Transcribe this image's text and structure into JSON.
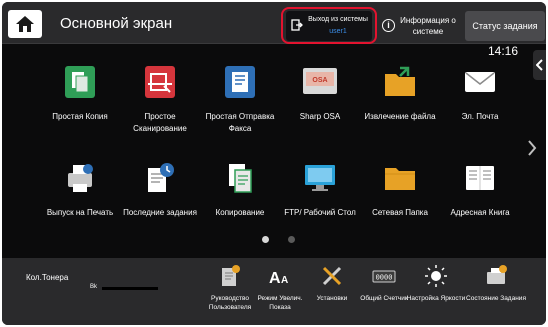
{
  "header": {
    "title": "Основной экран",
    "logout_label": "Выход из системы",
    "user_name": "user1",
    "info_label": "Информация о системе",
    "job_status_label": "Статус задания",
    "clock": "14:16"
  },
  "apps": [
    {
      "label": "Простая Копия",
      "icon": "copy-green-icon"
    },
    {
      "label": "Простое Сканирование",
      "icon": "scan-red-icon"
    },
    {
      "label": "Простая Отправка Факса",
      "icon": "fax-blue-icon"
    },
    {
      "label": "Sharp OSA",
      "icon": "sharp-osa-icon"
    },
    {
      "label": "Извлечение файла",
      "icon": "folder-retrieve-icon"
    },
    {
      "label": "Эл. Почта",
      "icon": "mail-icon"
    },
    {
      "label": "Выпуск на Печать",
      "icon": "print-release-icon"
    },
    {
      "label": "Последние задания",
      "icon": "recent-jobs-icon"
    },
    {
      "label": "Копирование",
      "icon": "copy-icon"
    },
    {
      "label": "FTP/ Рабочий Стол",
      "icon": "ftp-desktop-icon"
    },
    {
      "label": "Сетевая Папка",
      "icon": "network-folder-icon"
    },
    {
      "label": "Адресная Книга",
      "icon": "address-book-icon"
    }
  ],
  "pagination": {
    "pages": 2,
    "current": 1
  },
  "footer": {
    "toner_label": "Кол.Тонера",
    "toner_color": "Bk",
    "shortcuts": [
      {
        "label": "Руководство Пользователя",
        "icon": "manual-icon"
      },
      {
        "label": "Режим Увелич. Показа",
        "icon": "zoom-text-icon"
      },
      {
        "label": "Установки",
        "icon": "settings-tools-icon"
      },
      {
        "label": "Общий Счетчик",
        "icon": "counter-icon"
      },
      {
        "label": "Настройка Яркости",
        "icon": "brightness-icon"
      },
      {
        "label": "Состояние Задания",
        "icon": "job-status-icon"
      }
    ]
  },
  "colors": {
    "highlight": "#e3132f",
    "user": "#3b8ee8",
    "background": "#0b0b0c"
  }
}
